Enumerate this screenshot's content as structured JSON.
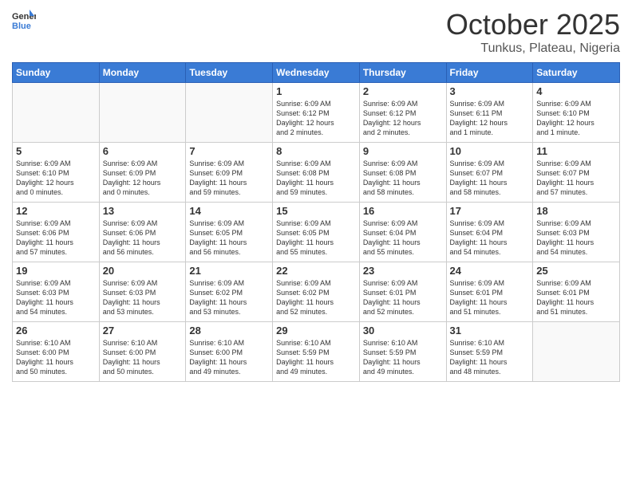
{
  "header": {
    "logo_general": "General",
    "logo_blue": "Blue",
    "month_title": "October 2025",
    "location": "Tunkus, Plateau, Nigeria"
  },
  "weekdays": [
    "Sunday",
    "Monday",
    "Tuesday",
    "Wednesday",
    "Thursday",
    "Friday",
    "Saturday"
  ],
  "weeks": [
    [
      {
        "day": "",
        "info": ""
      },
      {
        "day": "",
        "info": ""
      },
      {
        "day": "",
        "info": ""
      },
      {
        "day": "1",
        "info": "Sunrise: 6:09 AM\nSunset: 6:12 PM\nDaylight: 12 hours\nand 2 minutes."
      },
      {
        "day": "2",
        "info": "Sunrise: 6:09 AM\nSunset: 6:12 PM\nDaylight: 12 hours\nand 2 minutes."
      },
      {
        "day": "3",
        "info": "Sunrise: 6:09 AM\nSunset: 6:11 PM\nDaylight: 12 hours\nand 1 minute."
      },
      {
        "day": "4",
        "info": "Sunrise: 6:09 AM\nSunset: 6:10 PM\nDaylight: 12 hours\nand 1 minute."
      }
    ],
    [
      {
        "day": "5",
        "info": "Sunrise: 6:09 AM\nSunset: 6:10 PM\nDaylight: 12 hours\nand 0 minutes."
      },
      {
        "day": "6",
        "info": "Sunrise: 6:09 AM\nSunset: 6:09 PM\nDaylight: 12 hours\nand 0 minutes."
      },
      {
        "day": "7",
        "info": "Sunrise: 6:09 AM\nSunset: 6:09 PM\nDaylight: 11 hours\nand 59 minutes."
      },
      {
        "day": "8",
        "info": "Sunrise: 6:09 AM\nSunset: 6:08 PM\nDaylight: 11 hours\nand 59 minutes."
      },
      {
        "day": "9",
        "info": "Sunrise: 6:09 AM\nSunset: 6:08 PM\nDaylight: 11 hours\nand 58 minutes."
      },
      {
        "day": "10",
        "info": "Sunrise: 6:09 AM\nSunset: 6:07 PM\nDaylight: 11 hours\nand 58 minutes."
      },
      {
        "day": "11",
        "info": "Sunrise: 6:09 AM\nSunset: 6:07 PM\nDaylight: 11 hours\nand 57 minutes."
      }
    ],
    [
      {
        "day": "12",
        "info": "Sunrise: 6:09 AM\nSunset: 6:06 PM\nDaylight: 11 hours\nand 57 minutes."
      },
      {
        "day": "13",
        "info": "Sunrise: 6:09 AM\nSunset: 6:06 PM\nDaylight: 11 hours\nand 56 minutes."
      },
      {
        "day": "14",
        "info": "Sunrise: 6:09 AM\nSunset: 6:05 PM\nDaylight: 11 hours\nand 56 minutes."
      },
      {
        "day": "15",
        "info": "Sunrise: 6:09 AM\nSunset: 6:05 PM\nDaylight: 11 hours\nand 55 minutes."
      },
      {
        "day": "16",
        "info": "Sunrise: 6:09 AM\nSunset: 6:04 PM\nDaylight: 11 hours\nand 55 minutes."
      },
      {
        "day": "17",
        "info": "Sunrise: 6:09 AM\nSunset: 6:04 PM\nDaylight: 11 hours\nand 54 minutes."
      },
      {
        "day": "18",
        "info": "Sunrise: 6:09 AM\nSunset: 6:03 PM\nDaylight: 11 hours\nand 54 minutes."
      }
    ],
    [
      {
        "day": "19",
        "info": "Sunrise: 6:09 AM\nSunset: 6:03 PM\nDaylight: 11 hours\nand 54 minutes."
      },
      {
        "day": "20",
        "info": "Sunrise: 6:09 AM\nSunset: 6:03 PM\nDaylight: 11 hours\nand 53 minutes."
      },
      {
        "day": "21",
        "info": "Sunrise: 6:09 AM\nSunset: 6:02 PM\nDaylight: 11 hours\nand 53 minutes."
      },
      {
        "day": "22",
        "info": "Sunrise: 6:09 AM\nSunset: 6:02 PM\nDaylight: 11 hours\nand 52 minutes."
      },
      {
        "day": "23",
        "info": "Sunrise: 6:09 AM\nSunset: 6:01 PM\nDaylight: 11 hours\nand 52 minutes."
      },
      {
        "day": "24",
        "info": "Sunrise: 6:09 AM\nSunset: 6:01 PM\nDaylight: 11 hours\nand 51 minutes."
      },
      {
        "day": "25",
        "info": "Sunrise: 6:09 AM\nSunset: 6:01 PM\nDaylight: 11 hours\nand 51 minutes."
      }
    ],
    [
      {
        "day": "26",
        "info": "Sunrise: 6:10 AM\nSunset: 6:00 PM\nDaylight: 11 hours\nand 50 minutes."
      },
      {
        "day": "27",
        "info": "Sunrise: 6:10 AM\nSunset: 6:00 PM\nDaylight: 11 hours\nand 50 minutes."
      },
      {
        "day": "28",
        "info": "Sunrise: 6:10 AM\nSunset: 6:00 PM\nDaylight: 11 hours\nand 49 minutes."
      },
      {
        "day": "29",
        "info": "Sunrise: 6:10 AM\nSunset: 5:59 PM\nDaylight: 11 hours\nand 49 minutes."
      },
      {
        "day": "30",
        "info": "Sunrise: 6:10 AM\nSunset: 5:59 PM\nDaylight: 11 hours\nand 49 minutes."
      },
      {
        "day": "31",
        "info": "Sunrise: 6:10 AM\nSunset: 5:59 PM\nDaylight: 11 hours\nand 48 minutes."
      },
      {
        "day": "",
        "info": ""
      }
    ]
  ]
}
